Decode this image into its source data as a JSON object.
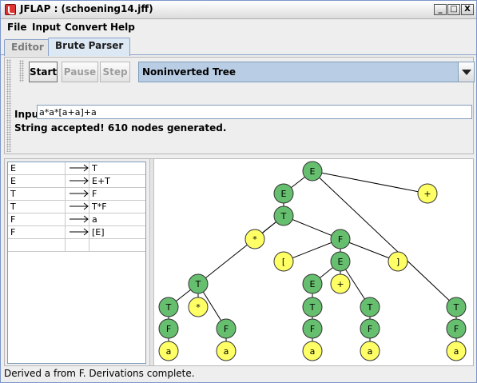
{
  "window": {
    "title": "JFLAP : (schoening14.jff)",
    "minimize_glyph": "_",
    "maximize_glyph": "□",
    "close_glyph": "X"
  },
  "menu": [
    "File",
    "Input",
    "Convert",
    "Help"
  ],
  "tabs": [
    {
      "label": "Editor",
      "active": false
    },
    {
      "label": "Brute Parser",
      "active": true
    }
  ],
  "toolbar": {
    "start": "Start",
    "pause": "Pause",
    "step": "Step",
    "view_mode": "Noninverted Tree"
  },
  "input": {
    "label": "Input",
    "value": "a*a*[a+a]+a"
  },
  "result_message": "String accepted!  610 nodes generated.",
  "grammar": [
    {
      "lhs": "E",
      "rhs": "T"
    },
    {
      "lhs": "E",
      "rhs": "E+T"
    },
    {
      "lhs": "T",
      "rhs": "F"
    },
    {
      "lhs": "T",
      "rhs": "T*F"
    },
    {
      "lhs": "F",
      "rhs": "a"
    },
    {
      "lhs": "F",
      "rhs": "[E]"
    },
    {
      "lhs": "",
      "rhs": ""
    }
  ],
  "parse_tree": {
    "nodes": [
      {
        "id": "n0",
        "label": "E",
        "kind": "nonterminal"
      },
      {
        "id": "n1",
        "label": "E",
        "kind": "nonterminal"
      },
      {
        "id": "n2",
        "label": "+",
        "kind": "terminal"
      },
      {
        "id": "n3",
        "label": "T",
        "kind": "nonterminal"
      },
      {
        "id": "n4",
        "label": "T",
        "kind": "nonterminal"
      },
      {
        "id": "n5",
        "label": "F",
        "kind": "nonterminal"
      },
      {
        "id": "n6",
        "label": "a",
        "kind": "terminal"
      },
      {
        "id": "n7",
        "label": "T",
        "kind": "nonterminal"
      },
      {
        "id": "n8",
        "label": "*",
        "kind": "terminal"
      },
      {
        "id": "n9",
        "label": "F",
        "kind": "nonterminal"
      },
      {
        "id": "n10",
        "label": "[",
        "kind": "terminal"
      },
      {
        "id": "n11",
        "label": "E",
        "kind": "nonterminal"
      },
      {
        "id": "n12",
        "label": "]",
        "kind": "terminal"
      },
      {
        "id": "n13",
        "label": "T",
        "kind": "nonterminal"
      },
      {
        "id": "n14",
        "label": "*",
        "kind": "terminal"
      },
      {
        "id": "n15",
        "label": "F",
        "kind": "nonterminal"
      },
      {
        "id": "n16",
        "label": "T",
        "kind": "nonterminal"
      },
      {
        "id": "n17",
        "label": "F",
        "kind": "nonterminal"
      },
      {
        "id": "n18",
        "label": "a",
        "kind": "terminal"
      },
      {
        "id": "n19",
        "label": "a",
        "kind": "terminal"
      },
      {
        "id": "n20",
        "label": "E",
        "kind": "nonterminal"
      },
      {
        "id": "n21",
        "label": "+",
        "kind": "terminal"
      },
      {
        "id": "n22",
        "label": "T",
        "kind": "nonterminal"
      },
      {
        "id": "n23",
        "label": "T",
        "kind": "nonterminal"
      },
      {
        "id": "n24",
        "label": "F",
        "kind": "nonterminal"
      },
      {
        "id": "n25",
        "label": "a",
        "kind": "terminal"
      },
      {
        "id": "n26",
        "label": "F",
        "kind": "nonterminal"
      },
      {
        "id": "n27",
        "label": "a",
        "kind": "terminal"
      }
    ],
    "edges": [
      [
        "n0",
        "n1"
      ],
      [
        "n0",
        "n2"
      ],
      [
        "n0",
        "n3"
      ],
      [
        "n3",
        "n4"
      ],
      [
        "n4",
        "n5"
      ],
      [
        "n5",
        "n6"
      ],
      [
        "n1",
        "n7"
      ],
      [
        "n7",
        "n13"
      ],
      [
        "n7",
        "n8"
      ],
      [
        "n7",
        "n9"
      ],
      [
        "n9",
        "n10"
      ],
      [
        "n9",
        "n11"
      ],
      [
        "n9",
        "n12"
      ],
      [
        "n13",
        "n16"
      ],
      [
        "n13",
        "n14"
      ],
      [
        "n13",
        "n15"
      ],
      [
        "n16",
        "n17"
      ],
      [
        "n17",
        "n18"
      ],
      [
        "n15",
        "n19"
      ],
      [
        "n11",
        "n20"
      ],
      [
        "n11",
        "n21"
      ],
      [
        "n11",
        "n22"
      ],
      [
        "n20",
        "n23"
      ],
      [
        "n23",
        "n24"
      ],
      [
        "n24",
        "n25"
      ],
      [
        "n22",
        "n26"
      ],
      [
        "n26",
        "n27"
      ]
    ]
  },
  "status_message": "Derived a from F.  Derivations complete.",
  "colors": {
    "nonterminal": "#66bf6f",
    "terminal": "#ffff66",
    "combo_background": "#b9cde4"
  }
}
